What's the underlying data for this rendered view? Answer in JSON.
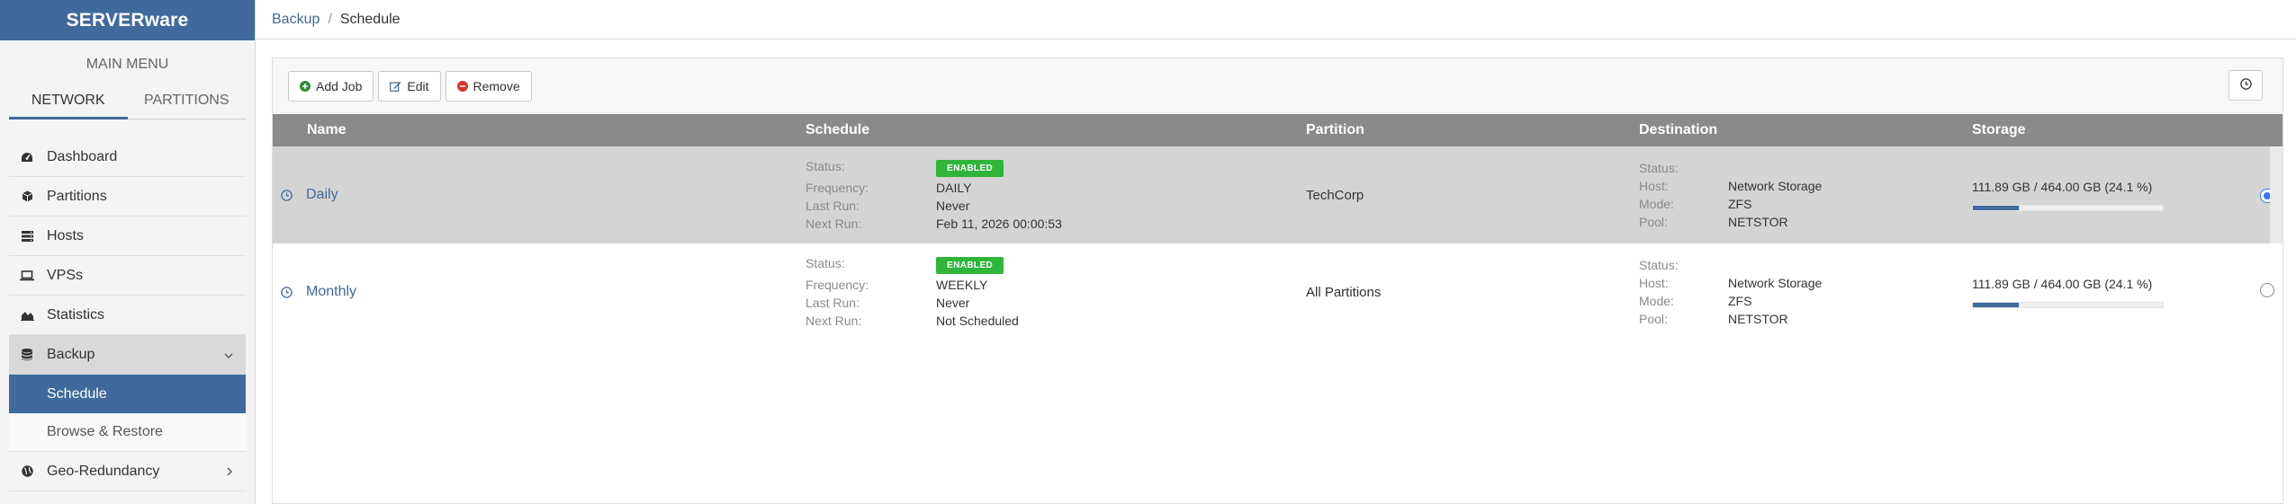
{
  "app": {
    "brand": "SERVERware"
  },
  "sidebar": {
    "menu_title": "MAIN MENU",
    "tabs": [
      {
        "label": "NETWORK",
        "active": true
      },
      {
        "label": "PARTITIONS",
        "active": false
      }
    ],
    "items": [
      {
        "label": "Dashboard",
        "icon": "dashboard-icon"
      },
      {
        "label": "Partitions",
        "icon": "cube-icon"
      },
      {
        "label": "Hosts",
        "icon": "server-icon"
      },
      {
        "label": "VPSs",
        "icon": "laptop-icon"
      },
      {
        "label": "Statistics",
        "icon": "area-chart-icon"
      },
      {
        "label": "Backup",
        "icon": "database-icon",
        "expanded": true
      },
      {
        "label": "Geo-Redundancy",
        "icon": "globe-icon"
      }
    ],
    "backup_children": [
      {
        "label": "Schedule",
        "active": true
      },
      {
        "label": "Browse & Restore",
        "active": false
      }
    ]
  },
  "breadcrumb": {
    "parent": "Backup",
    "separator": "/",
    "current": "Schedule"
  },
  "toolbar": {
    "add_label": "Add Job",
    "edit_label": "Edit",
    "remove_label": "Remove"
  },
  "table": {
    "columns": [
      "Name",
      "Schedule",
      "Partition",
      "Destination",
      "Storage"
    ],
    "rows": [
      {
        "name": "Daily",
        "selected": true,
        "status_label": "Status:",
        "status": "ENABLED",
        "frequency_label": "Frequency:",
        "frequency": "DAILY",
        "last_run_label": "Last Run:",
        "last_run": "Never",
        "next_run_label": "Next Run:",
        "next_run": "Feb 11, 2026 00:00:53",
        "partition": "TechCorp",
        "dest_status_label": "Status:",
        "host_label": "Host:",
        "host": "Network Storage",
        "mode_label": "Mode:",
        "mode": "ZFS",
        "pool_label": "Pool:",
        "pool": "NETSTOR",
        "storage_text": "111.89 GB / 464.00 GB (24.1 %)",
        "storage_fraction": 0.241
      },
      {
        "name": "Monthly",
        "selected": false,
        "status_label": "Status:",
        "status": "ENABLED",
        "frequency_label": "Frequency:",
        "frequency": "WEEKLY",
        "last_run_label": "Last Run:",
        "last_run": "Never",
        "next_run_label": "Next Run:",
        "next_run": "Not Scheduled",
        "partition": "All Partitions",
        "dest_status_label": "Status:",
        "host_label": "Host:",
        "host": "Network Storage",
        "mode_label": "Mode:",
        "mode": "ZFS",
        "pool_label": "Pool:",
        "pool": "NETSTOR",
        "storage_text": "111.89 GB / 464.00 GB (24.1 %)",
        "storage_fraction": 0.241
      }
    ]
  },
  "colors": {
    "brand": "#3f6a9b",
    "enabled": "#2fb53a",
    "header": "#8a8a8a",
    "selected_row": "#d4d4d4"
  }
}
